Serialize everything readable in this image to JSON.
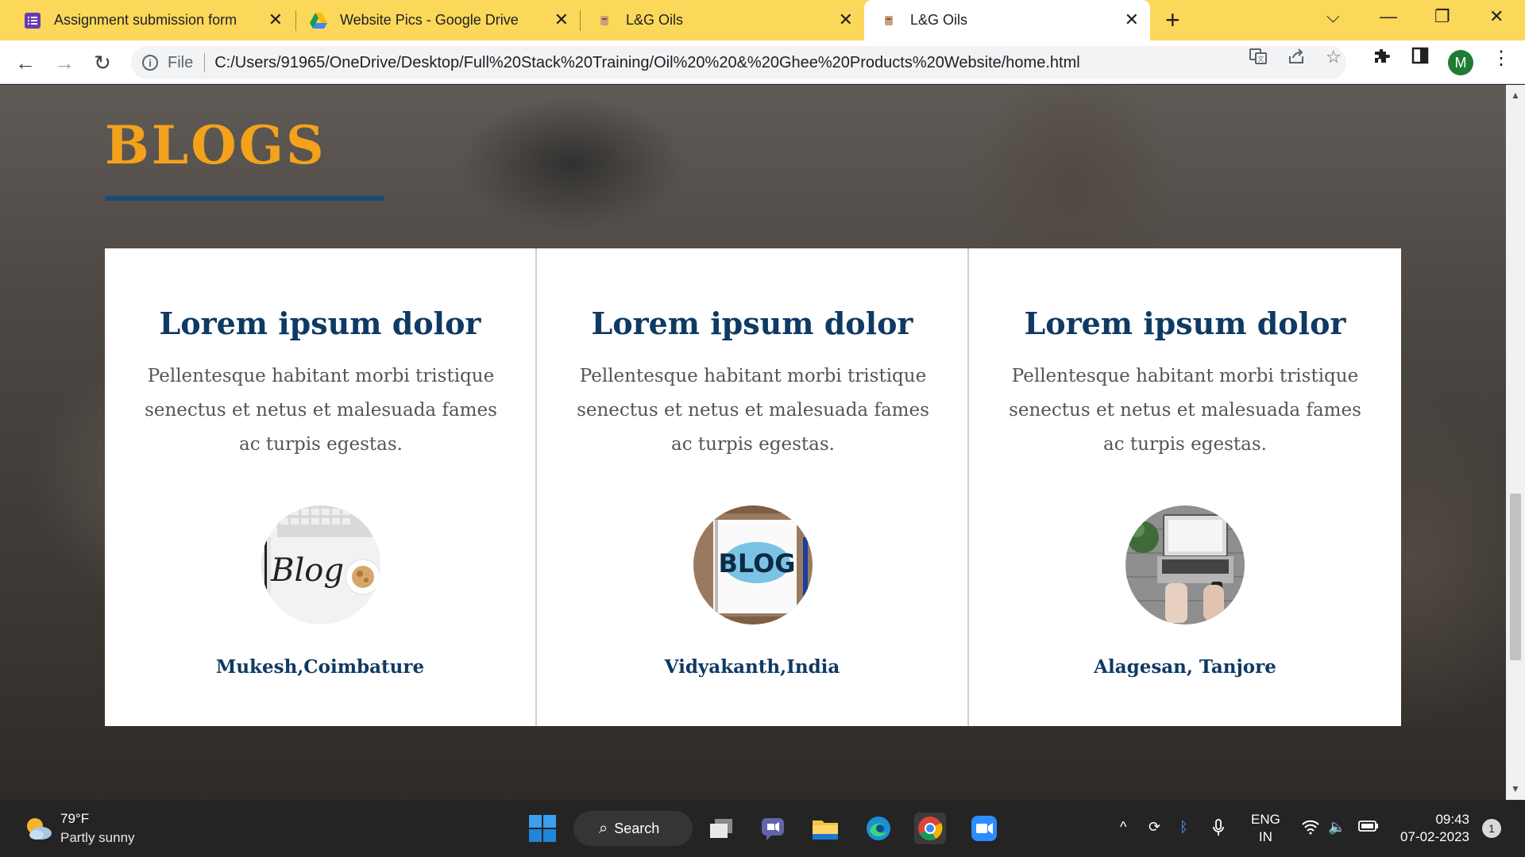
{
  "browser": {
    "tabs": [
      {
        "title": "Assignment submission form",
        "icon": "forms-icon"
      },
      {
        "title": "Website Pics - Google Drive",
        "icon": "google-drive-icon"
      },
      {
        "title": "L&G Oils",
        "icon": "site-favicon"
      },
      {
        "title": "L&G Oils",
        "icon": "site-favicon",
        "active": true
      }
    ],
    "address": {
      "scheme_label": "File",
      "url": "C:/Users/91965/OneDrive/Desktop/Full%20Stack%20Training/Oil%20%20&%20Ghee%20Products%20Website/home.html"
    },
    "profile_initial": "M",
    "colors": {
      "tabstrip": "#fbd85a",
      "profile": "#1e7d32"
    }
  },
  "page": {
    "section_title": "BLOGS",
    "colors": {
      "title": "#f4a11c",
      "underline": "#1c4a78",
      "card_heading": "#0e3a63"
    },
    "cards": [
      {
        "title": "Lorem ipsum dolor",
        "text": "Pellentesque habitant morbi tristique senectus et netus et malesuada fames ac turpis egestas.",
        "image": "blog-keyboard-image",
        "author": "Mukesh,Coimbature"
      },
      {
        "title": "Lorem ipsum dolor",
        "text": "Pellentesque habitant morbi tristique senectus et netus et malesuada fames ac turpis egestas.",
        "image": "blog-board-image",
        "author": "Vidyakanth,India"
      },
      {
        "title": "Lorem ipsum dolor",
        "text": "Pellentesque habitant morbi tristique senectus et netus et malesuada fames ac turpis egestas.",
        "image": "blog-laptop-image",
        "author": "Alagesan, Tanjore"
      }
    ]
  },
  "taskbar": {
    "weather_temp": "79°F",
    "weather_condition": "Partly sunny",
    "search_label": "Search",
    "language": "ENG",
    "region": "IN",
    "time": "09:43",
    "date": "07-02-2023",
    "notification_count": "1"
  }
}
